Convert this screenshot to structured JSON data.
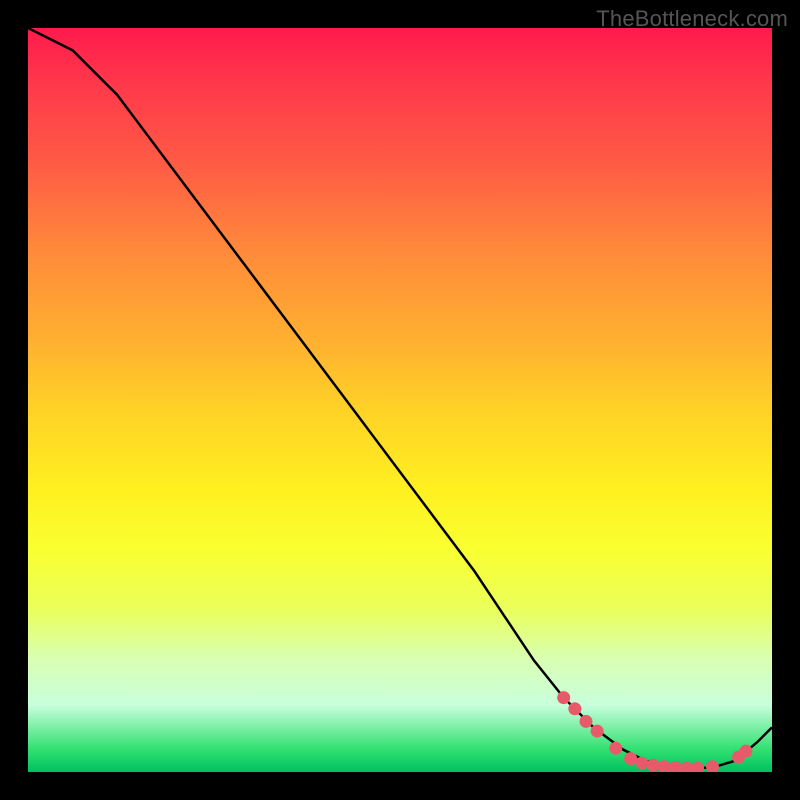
{
  "watermark": "TheBottleneck.com",
  "chart_data": {
    "type": "line",
    "title": "",
    "xlabel": "",
    "ylabel": "",
    "xlim": [
      0,
      100
    ],
    "ylim": [
      0,
      100
    ],
    "series": [
      {
        "name": "curve",
        "x": [
          0,
          6,
          12,
          18,
          24,
          30,
          36,
          42,
          48,
          54,
          60,
          64,
          68,
          72,
          76,
          80,
          83,
          86,
          89,
          92,
          95,
          98,
          100
        ],
        "y": [
          100,
          97,
          91,
          83,
          75,
          67,
          59,
          51,
          43,
          35,
          27,
          21,
          15,
          10,
          6,
          3,
          1.5,
          0.8,
          0.5,
          0.6,
          1.5,
          4,
          6
        ]
      }
    ],
    "markers": [
      {
        "x": 72.0,
        "y": 10.0
      },
      {
        "x": 73.5,
        "y": 8.5
      },
      {
        "x": 75.0,
        "y": 6.8
      },
      {
        "x": 76.5,
        "y": 5.5
      },
      {
        "x": 79.0,
        "y": 3.2
      },
      {
        "x": 81.0,
        "y": 1.8
      },
      {
        "x": 82.5,
        "y": 1.2
      },
      {
        "x": 84.0,
        "y": 0.9
      },
      {
        "x": 85.5,
        "y": 0.7
      },
      {
        "x": 87.0,
        "y": 0.6
      },
      {
        "x": 88.5,
        "y": 0.5
      },
      {
        "x": 90.0,
        "y": 0.5
      },
      {
        "x": 92.0,
        "y": 0.7
      },
      {
        "x": 95.5,
        "y": 2.0
      },
      {
        "x": 96.5,
        "y": 2.8
      }
    ],
    "marker_color": "#e85a6a",
    "line_color": "#000000"
  }
}
